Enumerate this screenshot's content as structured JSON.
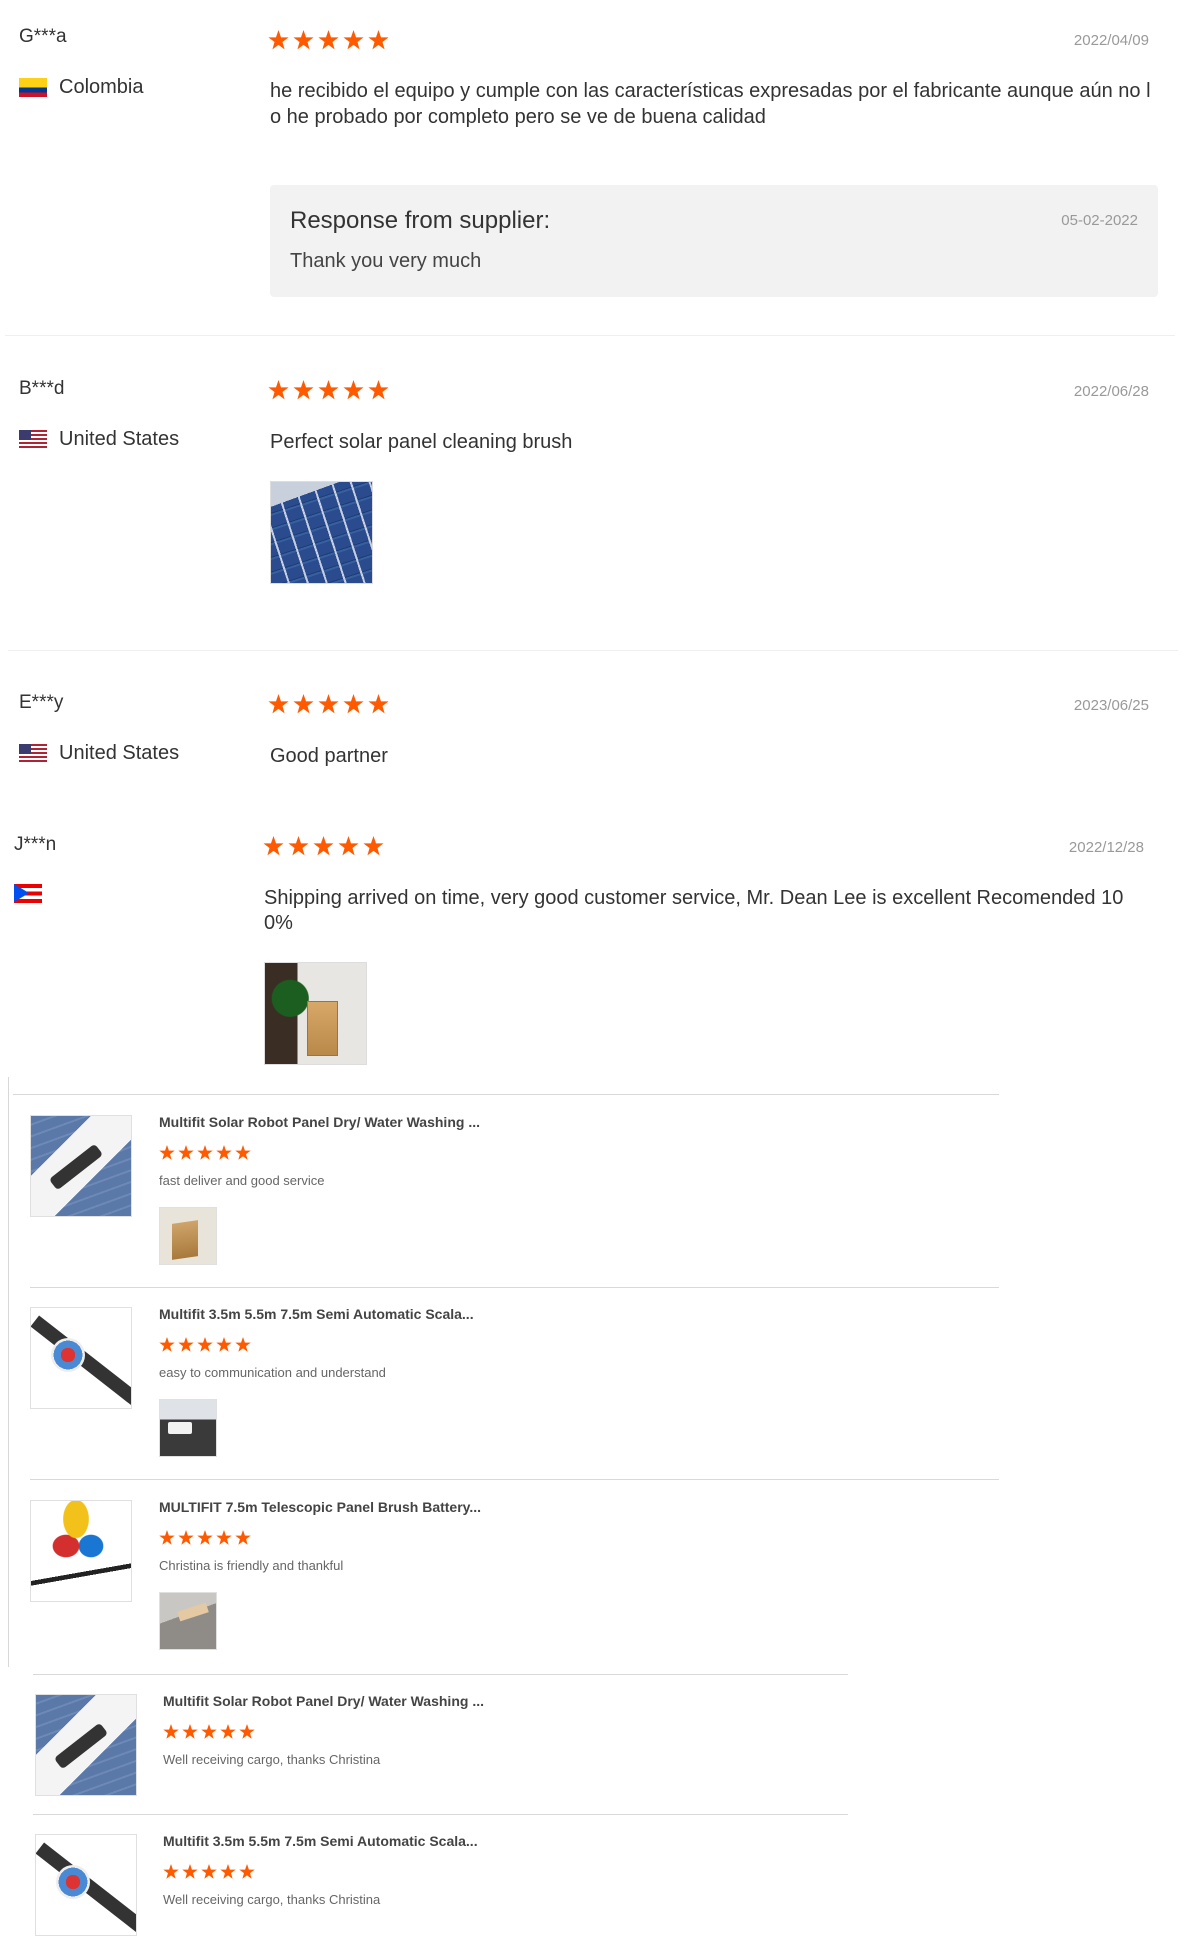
{
  "reviews": [
    {
      "reviewer": "G***a",
      "country": "Colombia",
      "rating": 5,
      "date": "2022/04/09",
      "text_line1": "he recibido el equipo y cumple con las características expresadas por el fabricante aunque aún no l",
      "text_line2": "o he probado por completo pero se ve de buena calidad",
      "supplier_response": {
        "title": "Response from supplier:",
        "date": "05-02-2022",
        "text": "Thank you very much"
      }
    },
    {
      "reviewer": "B***d",
      "country": "United States",
      "rating": 5,
      "date": "2022/06/28",
      "text": "Perfect solar panel cleaning brush"
    },
    {
      "reviewer": "E***y",
      "country": "United States",
      "rating": 5,
      "date": "2023/06/25",
      "text": "Good partner"
    },
    {
      "reviewer": "J***n",
      "country": "",
      "rating": 5,
      "date": "2022/12/28",
      "text_line1": "Shipping arrived on time, very good customer service, Mr. Dean Lee is excellent Recomended 10",
      "text_line2": "0%"
    }
  ],
  "product_reviews": [
    {
      "product_title": "Multifit Solar Robot Panel Dry/ Water Washing ...",
      "rating": 5,
      "text": "fast deliver and good service"
    },
    {
      "product_title": "Multifit 3.5m 5.5m 7.5m Semi Automatic Scala...",
      "rating": 5,
      "text": "easy to communication and understand"
    },
    {
      "product_title": "MULTIFIT 7.5m Telescopic Panel Brush Battery...",
      "rating": 5,
      "text": "Christina is friendly and thankful"
    },
    {
      "product_title": "Multifit Solar Robot Panel Dry/ Water Washing ...",
      "rating": 5,
      "text": "Well receiving cargo, thanks Christina"
    },
    {
      "product_title": "Multifit 3.5m 5.5m 7.5m Semi Automatic Scala...",
      "rating": 5,
      "text": "Well receiving cargo, thanks Christina"
    }
  ],
  "colors": {
    "star": "#ff5a00",
    "date": "#999999",
    "reply_bg": "#f2f2f2"
  },
  "icons": [
    "flag-colombia-icon",
    "flag-us-icon",
    "flag-puerto-rico-icon",
    "star-icon"
  ]
}
